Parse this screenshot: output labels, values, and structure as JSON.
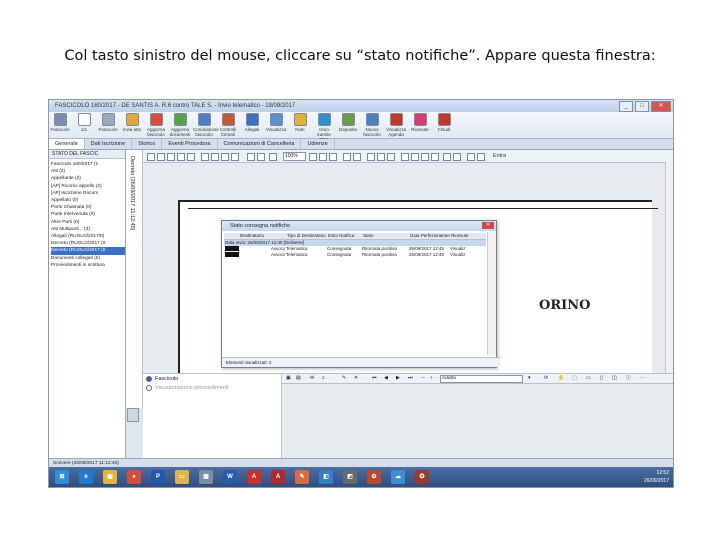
{
  "caption": "Col tasto sinistro del mouse, cliccare su “stato notifiche”. Appare questa finestra:",
  "window": {
    "title": "FASCICOLO 160/2017 - DE SANTIS A. R.6 contro TALE S. - Invio telematico - 19/09/2017",
    "minimize": "_",
    "maximize": "□",
    "close": "✕"
  },
  "ribbon": [
    {
      "label": "Fascicolo",
      "color": "#7d8fa8"
    },
    {
      "label": "1/1",
      "color": "#ffffff"
    },
    {
      "label": "Fascicolo",
      "color": "#9aa8bb"
    },
    {
      "label": "Invia atto",
      "color": "#e0a83a"
    },
    {
      "label": "Aggiorna fascicolo",
      "color": "#d94c3a"
    },
    {
      "label": "Aggiorna documenti",
      "color": "#5aa04a"
    },
    {
      "label": "Condivisione fascicolo",
      "color": "#4e7fc4"
    },
    {
      "label": "Controlli formali",
      "color": "#c25a3a"
    },
    {
      "label": "Allegati",
      "color": "#3f6fbf"
    },
    {
      "label": "Visualizza",
      "color": "#5a8fd0"
    },
    {
      "label": "Note",
      "color": "#d9b43a"
    },
    {
      "label": "Invio tramite PEC",
      "color": "#2f8fcf"
    },
    {
      "label": "Deposita",
      "color": "#6a9a4a"
    },
    {
      "label": "Nuovo fascicolo",
      "color": "#4a7fc0"
    },
    {
      "label": "Visualizza Agenda",
      "color": "#c0392b"
    },
    {
      "label": "Ricevute",
      "color": "#d43f6f"
    },
    {
      "label": "Chiudi",
      "color": "#c0392b"
    }
  ],
  "tabs": [
    "Generale",
    "Dati Iscrizione",
    "Storico",
    "Eventi Procedura",
    "Comunicazioni di Cancelleria",
    "Udienze"
  ],
  "left_pane": {
    "header": "STATO DEL FASCIC",
    "items": [
      {
        "label": "Fascicolo 160/2017 (1",
        "selected": false
      },
      {
        "label": "Atti (2)",
        "selected": false
      },
      {
        "label": "Appellante (2)",
        "selected": false
      },
      {
        "label": "[AP] Ricorso appello (2)",
        "selected": false
      },
      {
        "label": "[AP] Iscrizione Docum",
        "selected": false
      },
      {
        "label": "Appellato (0)",
        "selected": false
      },
      {
        "label": "Parte Chiamata (0)",
        "selected": false
      },
      {
        "label": "Parte Intervenuta (0)",
        "selected": false
      },
      {
        "label": "Altre Parti (0)",
        "selected": false
      },
      {
        "label": "Atti Multiparti... (3)",
        "selected": false
      },
      {
        "label": "Allegati (RUOLO/2017/0)",
        "selected": false
      },
      {
        "label": "Decreto (RUOLO/2017 (0",
        "selected": false
      },
      {
        "label": "Decreto (RUOLO/2017 (0",
        "selected": true
      },
      {
        "label": "Documenti collegati (0)",
        "selected": false
      },
      {
        "label": "Provvedimenti in scrittura",
        "selected": false
      }
    ]
  },
  "doc_strip_label": "Decreto (26/09/2017 11:12:45)",
  "viewer": {
    "zoom": "100%",
    "entra_label": "Entra",
    "page_text": "ORINO"
  },
  "dialog": {
    "title": "Stato consegna notifiche",
    "close": "✕",
    "columns": [
      "",
      "Destinatario",
      "Tipo di Destinatario",
      "Esito Notifica",
      "Stato",
      "Data Perfezionamento",
      "Ricevute"
    ],
    "group_label": "Data invio: 26/09/2017 12:45 [Deliverer]",
    "rows": [
      {
        "c1": "",
        "c2": "Avvocato",
        "c3": "Telematica",
        "c4": "Consegnata",
        "c5": "Ritornata positiva",
        "c6": "26/09/2017 12:45",
        "c7": "Visualiz"
      },
      {
        "c1": "",
        "c2": "Avvocato",
        "c3": "Telematica",
        "c4": "Consegnata",
        "c5": "Ritornata positiva",
        "c6": "26/09/2017 12:45",
        "c7": "Visualiz"
      }
    ],
    "status": "Elementi visualizzati: 2"
  },
  "bottom": {
    "radio_on": "Fascicolo",
    "radio_off": "Visualizzazione provvedimenti",
    "zoom": "Adatta"
  },
  "statusbar": "Scrivere (26/09/2017 11:12:45)",
  "taskbar": {
    "apps": [
      {
        "name": "start-orb",
        "label": "⊞",
        "color": "#2d8fd5"
      },
      {
        "name": "ie",
        "label": "e",
        "color": "#1f7ad0"
      },
      {
        "name": "explorer",
        "label": "▣",
        "color": "#e8b33a"
      },
      {
        "name": "chrome",
        "label": "●",
        "color": "#d94c3a"
      },
      {
        "name": "pct",
        "label": "P",
        "color": "#2457a7"
      },
      {
        "name": "folder",
        "label": "▭",
        "color": "#e3b34a"
      },
      {
        "name": "calc",
        "label": "▦",
        "color": "#7a8fa3"
      },
      {
        "name": "word",
        "label": "W",
        "color": "#2a5ba8"
      },
      {
        "name": "pdf",
        "label": "A",
        "color": "#c9302c"
      },
      {
        "name": "pdf2",
        "label": "A",
        "color": "#b02a2a"
      },
      {
        "name": "paint",
        "label": "✎",
        "color": "#d96c3a"
      },
      {
        "name": "app2",
        "label": "◧",
        "color": "#3a7fc0"
      },
      {
        "name": "app3",
        "label": "◩",
        "color": "#6a6a6a"
      },
      {
        "name": "seal",
        "label": "✿",
        "color": "#b74a2a"
      },
      {
        "name": "cloud",
        "label": "☁",
        "color": "#3c8fd0"
      },
      {
        "name": "emblem",
        "label": "✪",
        "color": "#9a3a2a"
      }
    ],
    "time": "12:52",
    "date": "26/09/2017"
  }
}
